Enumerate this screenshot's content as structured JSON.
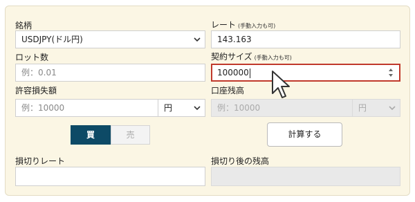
{
  "labels": {
    "symbol": "銘柄",
    "rate": "レート",
    "rate_note": "(手動入力も可)",
    "lot": "ロット数",
    "contract_size": "契約サイズ",
    "contract_note": "(手動入力も可)",
    "loss_amount": "許容損失額",
    "balance": "口座残高",
    "stop_rate": "損切りレート",
    "balance_after": "損切り後の残高"
  },
  "fields": {
    "symbol_value": "USDJPY(ドル円)",
    "rate_value": "143.163",
    "lot_placeholder": "例：0.01",
    "contract_value": "100000",
    "loss_placeholder": "例：10000",
    "loss_currency": "円",
    "balance_placeholder": "例：10000",
    "balance_currency": "円"
  },
  "buttons": {
    "buy": "買",
    "sell": "売",
    "calculate": "計算する"
  },
  "colors": {
    "panel_bg": "#fbf6e4",
    "buy_bg": "#0d4a66",
    "focus_border": "#c0392b"
  }
}
